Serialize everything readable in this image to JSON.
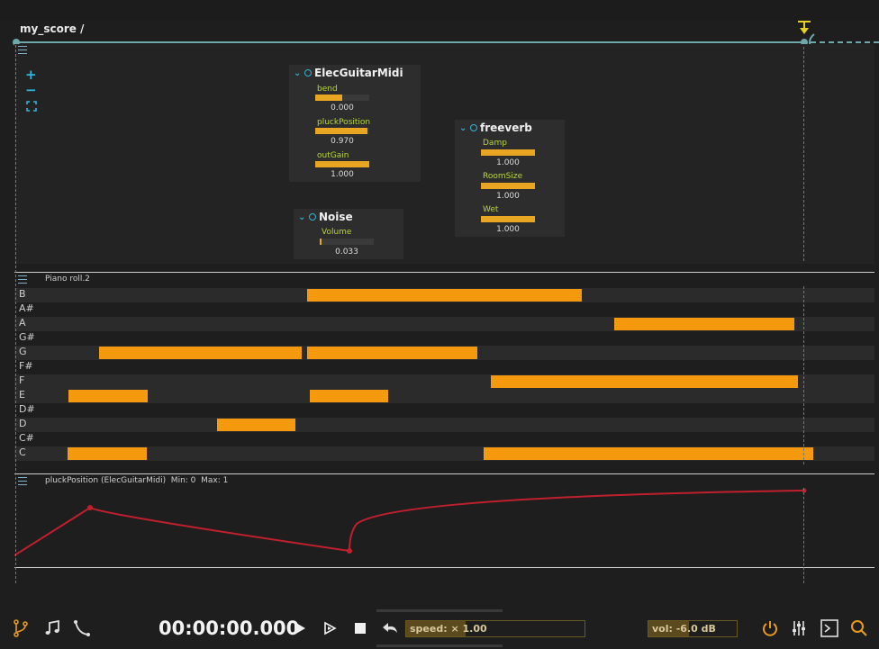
{
  "score": {
    "title": "my_score /"
  },
  "processors": [
    {
      "title": "ElecGuitarMidi",
      "params": [
        {
          "label": "bend",
          "value": "0.000",
          "level": 0.5
        },
        {
          "label": "pluckPosition",
          "value": "0.970",
          "level": 0.97
        },
        {
          "label": "outGain",
          "value": "1.000",
          "level": 1.0
        }
      ]
    },
    {
      "title": "freeverb",
      "params": [
        {
          "label": "Damp",
          "value": "1.000",
          "level": 1.0
        },
        {
          "label": "RoomSize",
          "value": "1.000",
          "level": 1.0
        },
        {
          "label": "Wet",
          "value": "1.000",
          "level": 1.0
        }
      ]
    },
    {
      "title": "Noise",
      "params": [
        {
          "label": "Volume",
          "value": "0.033",
          "level": 0.033
        }
      ]
    }
  ],
  "zoom": {
    "in": "+",
    "out": "−",
    "fit": "⛶"
  },
  "piano_roll": {
    "title": "Piano roll.2",
    "notes": [
      "B",
      "A#",
      "A",
      "G#",
      "G",
      "F#",
      "F",
      "E",
      "D#",
      "D",
      "C#",
      "C"
    ]
  },
  "automation": {
    "title": "pluckPosition (ElecGuitarMidi)  Min: 0  Max: 1"
  },
  "transport": {
    "time": "00:00:00.000",
    "speed": "speed: × 1.00",
    "speed_level": 0.33,
    "volume": "vol: -6.0 dB",
    "volume_level": 0.45
  },
  "icons": {
    "branch": "branch-icon",
    "music": "music-note-icon",
    "curve": "curve-icon",
    "play": "play-icon",
    "play_from": "play-from-start-icon",
    "stop": "stop-icon",
    "loop": "loop-back-icon",
    "power": "power-icon",
    "mixer": "mixer-icon",
    "console": "console-icon",
    "search": "search-icon"
  },
  "colors": {
    "accent": "#32b5d6",
    "note": "#f59a0f",
    "param_fill": "#e8a623",
    "param_label": "#b6d63a",
    "automation_curve": "#c0202e",
    "power": "#e89a1a"
  }
}
